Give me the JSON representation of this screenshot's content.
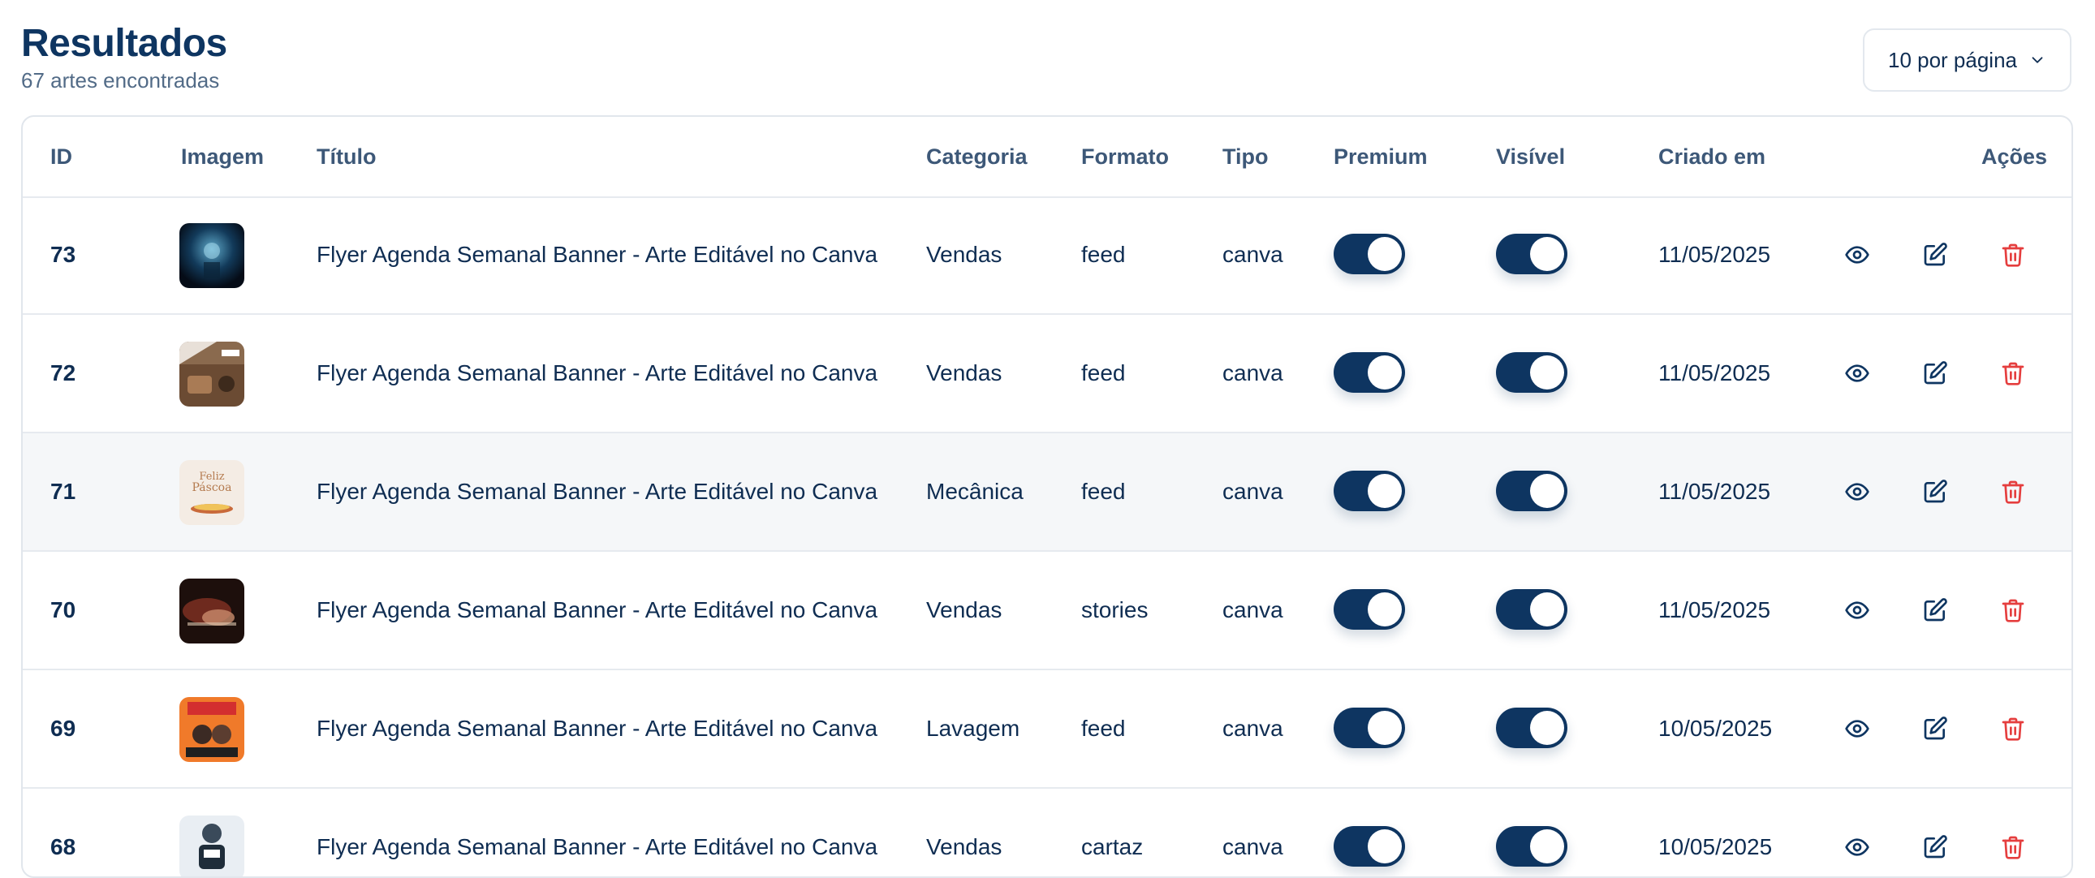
{
  "header": {
    "title": "Resultados",
    "subtitle": "67 artes encontradas",
    "per_page_label": "10 por página"
  },
  "table": {
    "columns": {
      "id": "ID",
      "image": "Imagem",
      "title": "Título",
      "category": "Categoria",
      "format": "Formato",
      "type": "Tipo",
      "premium": "Premium",
      "visible": "Visível",
      "created": "Criado em",
      "actions": "Ações"
    },
    "rows": [
      {
        "id": "73",
        "title": "Flyer Agenda Semanal Banner - Arte Editável no Canva",
        "category": "Vendas",
        "format": "feed",
        "type": "canva",
        "premium": true,
        "visible": true,
        "created": "11/05/2025",
        "thumb": "thumb-blue"
      },
      {
        "id": "72",
        "title": "Flyer Agenda Semanal Banner - Arte Editável no Canva",
        "category": "Vendas",
        "format": "feed",
        "type": "canva",
        "premium": true,
        "visible": true,
        "created": "11/05/2025",
        "thumb": "thumb-brown"
      },
      {
        "id": "71",
        "title": "Flyer Agenda Semanal Banner - Arte Editável no Canva",
        "category": "Mecânica",
        "format": "feed",
        "type": "canva",
        "premium": true,
        "visible": true,
        "created": "11/05/2025",
        "thumb": "thumb-cream"
      },
      {
        "id": "70",
        "title": "Flyer Agenda Semanal Banner - Arte Editável no Canva",
        "category": "Vendas",
        "format": "stories",
        "type": "canva",
        "premium": true,
        "visible": true,
        "created": "11/05/2025",
        "thumb": "thumb-dark"
      },
      {
        "id": "69",
        "title": "Flyer Agenda Semanal Banner - Arte Editável no Canva",
        "category": "Lavagem",
        "format": "feed",
        "type": "canva",
        "premium": true,
        "visible": true,
        "created": "10/05/2025",
        "thumb": "thumb-orange"
      },
      {
        "id": "68",
        "title": "Flyer Agenda Semanal Banner - Arte Editável no Canva",
        "category": "Vendas",
        "format": "cartaz",
        "type": "canva",
        "premium": true,
        "visible": true,
        "created": "10/05/2025",
        "thumb": "thumb-light"
      }
    ]
  },
  "colors": {
    "primary": "#0e3561",
    "delete": "#e53e3e",
    "row_alt": "#f5f7f9"
  },
  "icons": {
    "view": "eye-icon",
    "edit": "edit-icon",
    "delete": "trash-icon",
    "dropdown": "chevron-down-icon"
  }
}
